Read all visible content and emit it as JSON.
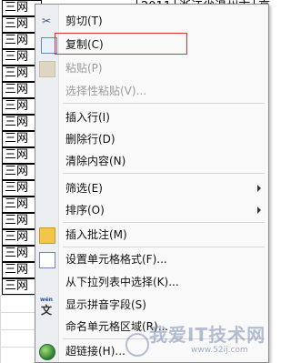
{
  "sheet": {
    "cell_text": "三网",
    "top_cells": [
      "2011",
      "浙江省温州市",
      "高"
    ],
    "rows": 18
  },
  "menu": {
    "items": [
      {
        "label": "剪切(T)",
        "icon": "scissors-icon",
        "enabled": true
      },
      {
        "label": "复制(C)",
        "icon": "copy-icon",
        "enabled": true,
        "highlighted": true
      },
      {
        "label": "粘贴(P)",
        "icon": "paste-icon",
        "enabled": false
      },
      {
        "label": "选择性粘贴(V)...",
        "icon": "",
        "enabled": false
      },
      {
        "label": "插入行(I)",
        "icon": "",
        "enabled": true
      },
      {
        "label": "删除行(D)",
        "icon": "",
        "enabled": true
      },
      {
        "label": "清除内容(N)",
        "icon": "",
        "enabled": true
      },
      {
        "label": "筛选(E)",
        "icon": "",
        "enabled": true,
        "submenu": true
      },
      {
        "label": "排序(O)",
        "icon": "",
        "enabled": true,
        "submenu": true
      },
      {
        "label": "插入批注(M)",
        "icon": "insert-comment-icon",
        "enabled": true
      },
      {
        "label": "设置单元格格式(F)...",
        "icon": "format-cells-icon",
        "enabled": true
      },
      {
        "label": "从下拉列表中选择(K)...",
        "icon": "",
        "enabled": true
      },
      {
        "label": "显示拼音字段(S)",
        "icon": "phonetic-icon",
        "enabled": true
      },
      {
        "label": "命名单元格区域(R)...",
        "icon": "",
        "enabled": true
      },
      {
        "label": "超链接(H)...",
        "icon": "hyperlink-icon",
        "enabled": true
      }
    ],
    "phonetic_icon_text": {
      "top": "wén",
      "main": "文"
    }
  },
  "watermark": {
    "main": "我爱IT技术网",
    "url": "www.52ij.com"
  },
  "colors": {
    "highlight_border": "#e0312f",
    "menu_bg": "#f9f9f9",
    "gutter_bg": "#eceef1"
  }
}
